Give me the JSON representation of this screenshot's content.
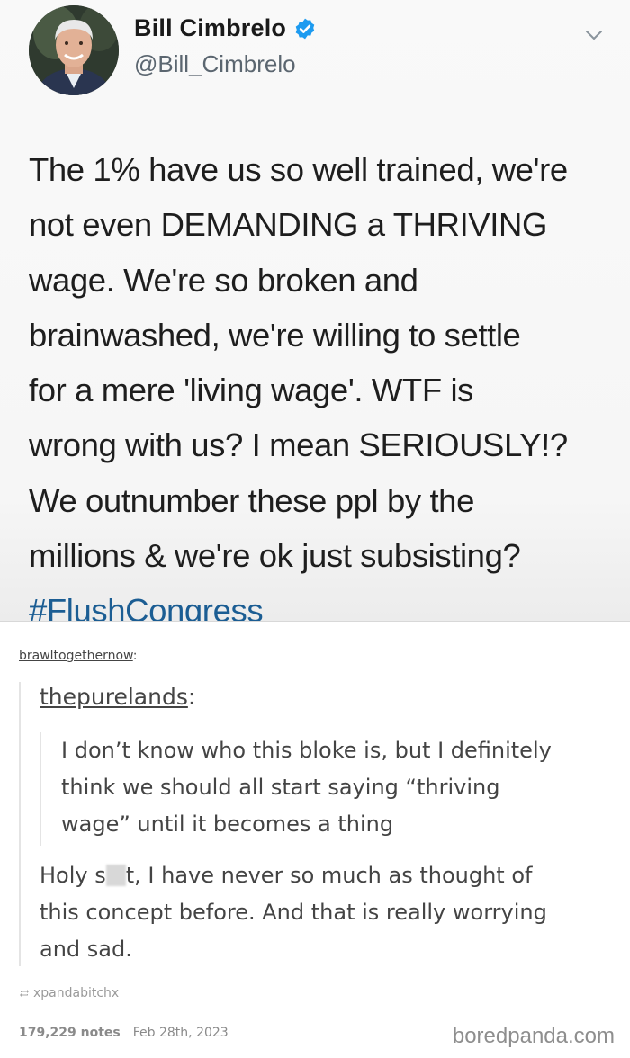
{
  "tweet": {
    "display_name": "Bill Cimbrelo",
    "handle": "@Bill_Cimbrelo",
    "verified_icon": "verified-badge-icon",
    "menu_icon": "chevron-down-icon",
    "lines": [
      "The 1% have us so well trained, we're",
      "not even DEMANDING a THRIVING",
      "wage. We're so broken and",
      "brainwashed, we're willing to settle",
      "for a mere 'living wage'. WTF is",
      "wrong with us? I mean SERIOUSLY!?",
      "We outnumber these ppl by the",
      "millions & we're ok just subsisting?"
    ],
    "hashtag": "#FlushCongress",
    "colors": {
      "hashtag": "#1b5d93",
      "verified": "#1d9bf0"
    }
  },
  "thread": {
    "reblog_user": "brawltogethernow",
    "reblog_suffix": ":",
    "quoted_user": "thepurelands",
    "quoted_suffix": ":",
    "quote_lines": [
      "I don’t know who this bloke is, but I definitely",
      "think we should all start saying “thriving",
      "wage” until it becomes a thing"
    ],
    "reply_first_before": "Holy s",
    "reply_first_after": "t, I have never so much as thought of",
    "reply_lines": [
      "this concept before. And that is really worrying",
      "and sad."
    ]
  },
  "footer": {
    "source_icon": "reblog-icon",
    "source_user": "xpandabitchx",
    "notes": "179,229 notes",
    "date": "Feb 28th, 2023",
    "watermark": "boredpanda.com"
  }
}
